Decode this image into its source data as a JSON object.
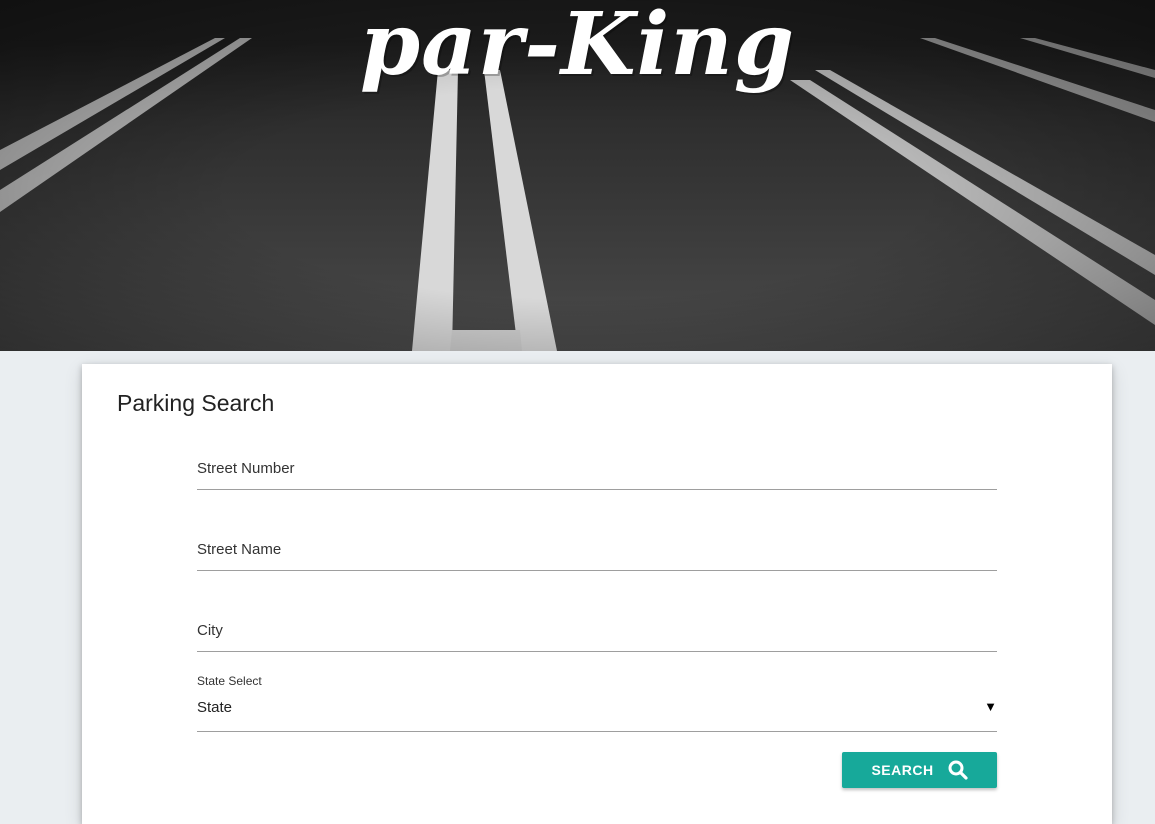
{
  "header": {
    "logo_text": "par-King"
  },
  "form": {
    "title": "Parking Search",
    "fields": [
      {
        "placeholder": "Street Number",
        "value": ""
      },
      {
        "placeholder": "Street Name",
        "value": ""
      },
      {
        "placeholder": "City",
        "value": ""
      }
    ],
    "state_select": {
      "label": "State Select",
      "selected": "State",
      "caret": "▼"
    },
    "search_button": {
      "label": "SEARCH",
      "icon": "search-icon"
    }
  },
  "colors": {
    "accent": "#17a99a",
    "page_background": "#eaeef1",
    "card_background": "#ffffff"
  }
}
